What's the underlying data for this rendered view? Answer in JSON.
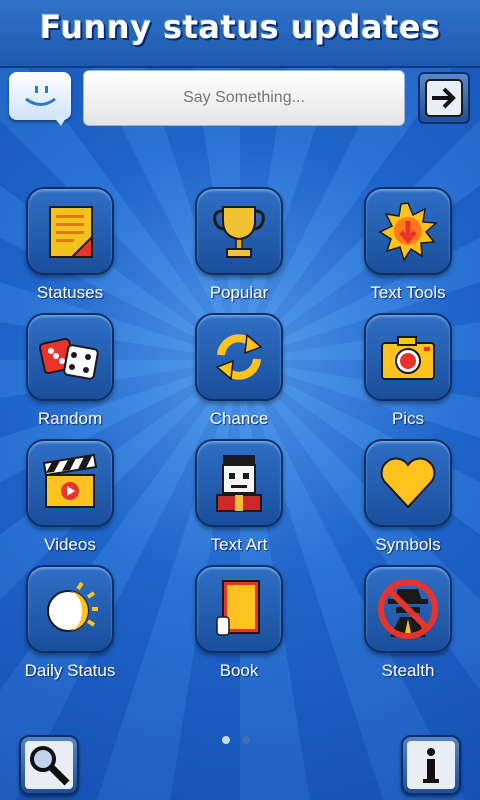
{
  "app": {
    "title": "Funny status updates"
  },
  "status_input": {
    "placeholder": "Say Something..."
  },
  "icons": {
    "smiley": "smiley-speech-icon",
    "submit": "arrow-right-icon",
    "search": "magnifier-icon",
    "info": "info-icon"
  },
  "grid": {
    "items": [
      {
        "label": "Statuses",
        "icon": "notepad-icon"
      },
      {
        "label": "Popular",
        "icon": "trophy-icon"
      },
      {
        "label": "Text Tools",
        "icon": "starburst-arrow-icon"
      },
      {
        "label": "Random",
        "icon": "dice-icon"
      },
      {
        "label": "Chance",
        "icon": "refresh-arrows-icon"
      },
      {
        "label": "Pics",
        "icon": "camera-icon"
      },
      {
        "label": "Videos",
        "icon": "clapperboard-icon"
      },
      {
        "label": "Text Art",
        "icon": "pixel-face-icon"
      },
      {
        "label": "Symbols",
        "icon": "heart-icon"
      },
      {
        "label": "Daily Status",
        "icon": "sun-moon-icon"
      },
      {
        "label": "Book",
        "icon": "book-icon"
      },
      {
        "label": "Stealth",
        "icon": "no-spy-icon"
      }
    ]
  },
  "pager": {
    "pages": 2,
    "current": 1
  },
  "colors": {
    "background": "#1f63c4",
    "tile": "#1b4f9d",
    "accent_yellow": "#ffd400",
    "accent_red": "#e8342a"
  }
}
